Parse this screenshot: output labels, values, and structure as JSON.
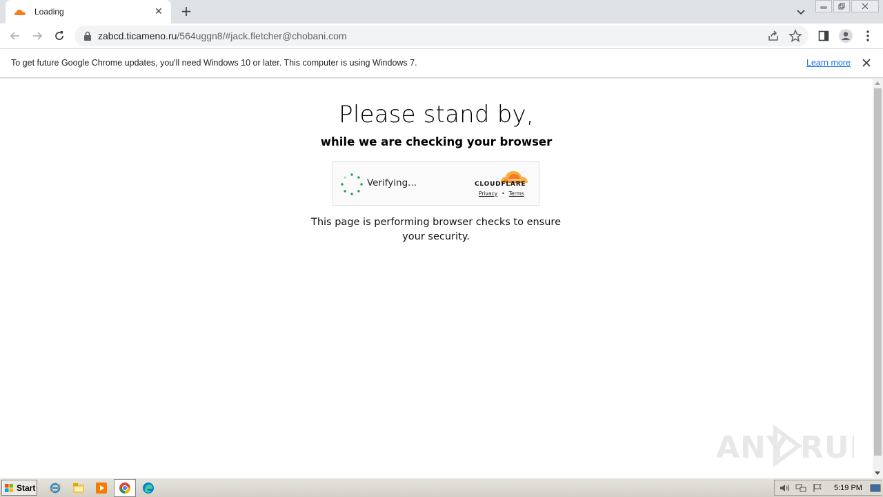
{
  "browser": {
    "tab": {
      "title": "Loading",
      "close_icon": "close-icon",
      "favicon": "cloudflare-favicon"
    },
    "new_tab_label": "+",
    "toolbar": {
      "back_icon": "back-arrow-icon",
      "forward_icon": "forward-arrow-icon",
      "reload_icon": "reload-icon"
    },
    "address_bar": {
      "host": "zabcd.ticameno.ru",
      "path": "/564uggn8/#jack.fletcher@chobani.com"
    }
  },
  "infobar": {
    "message": "To get future Google Chrome updates, you'll need Windows 10 or later. This computer is using Windows 7.",
    "link_label": "Learn more"
  },
  "page": {
    "heading": "Please stand by,",
    "subheading": "while we are checking your browser",
    "widget": {
      "status": "Verifying...",
      "brand": "CLOUDFLARE",
      "privacy_link": "Privacy",
      "separator": "•",
      "terms_link": "Terms"
    },
    "description": "This page is performing browser checks to ensure your security."
  },
  "watermark": {
    "text": "ANY RUN"
  },
  "taskbar": {
    "start_label": "Start",
    "clock": "5:19 PM"
  },
  "colors": {
    "cloudflare_orange": "#f38020",
    "cloudflare_light": "#faae40",
    "spinner_green": "#1f9d55",
    "link_blue": "#1a73e8"
  }
}
